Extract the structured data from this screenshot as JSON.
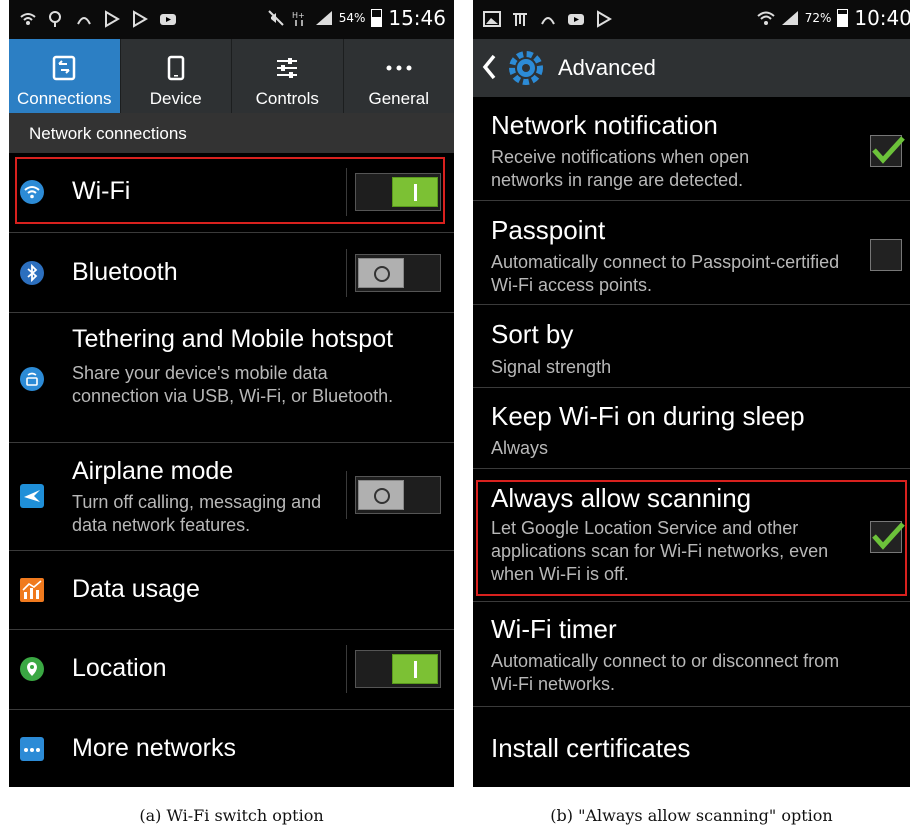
{
  "phone_a": {
    "status": {
      "battery_pct": "54%",
      "time": "15:46",
      "battery_level": 54
    },
    "tabs": [
      {
        "label": "Connections",
        "icon": "connections-icon",
        "active": true
      },
      {
        "label": "Device",
        "icon": "device-icon",
        "active": false
      },
      {
        "label": "Controls",
        "icon": "controls-icon",
        "active": false
      },
      {
        "label": "General",
        "icon": "more-dots-icon",
        "active": false
      }
    ],
    "section_header": "Network connections",
    "rows": [
      {
        "title": "Wi-Fi",
        "icon": "wifi-icon",
        "toggle": "on"
      },
      {
        "title": "Bluetooth",
        "icon": "bluetooth-icon",
        "toggle": "off"
      },
      {
        "title": "Tethering and Mobile hotspot",
        "subtitle": "Share your device's mobile data connection via USB, Wi-Fi, or Bluetooth.",
        "icon": "hotspot-icon"
      },
      {
        "title": "Airplane mode",
        "subtitle": "Turn off calling, messaging and data network features.",
        "icon": "airplane-icon",
        "toggle": "off"
      },
      {
        "title": "Data usage",
        "icon": "data-usage-icon"
      },
      {
        "title": "Location",
        "icon": "location-icon",
        "toggle": "on"
      },
      {
        "title": "More networks",
        "icon": "more-networks-icon"
      }
    ],
    "caption": "(a) Wi-Fi switch option"
  },
  "phone_b": {
    "status": {
      "battery_pct": "72%",
      "time": "10:40",
      "battery_level": 72
    },
    "action_bar_title": "Advanced",
    "rows": [
      {
        "title": "Network notification",
        "subtitle": "Receive notifications when open networks in range are detected.",
        "checked": true
      },
      {
        "title": "Passpoint",
        "subtitle": "Automatically connect to Passpoint-certified Wi-Fi access points.",
        "checked": false
      },
      {
        "title": "Sort by",
        "subtitle": "Signal strength"
      },
      {
        "title": "Keep Wi-Fi on during sleep",
        "subtitle": "Always"
      },
      {
        "title": "Always allow scanning",
        "subtitle": "Let Google Location Service and other applications scan for Wi-Fi networks, even when Wi-Fi is off.",
        "checked": true
      },
      {
        "title": "Wi-Fi timer",
        "subtitle": "Automatically connect to or disconnect from Wi-Fi networks."
      },
      {
        "title": "Install certificates"
      }
    ],
    "caption": "(b) \"Always allow scanning\" option"
  },
  "colors": {
    "accent_blue": "#2c7fc4",
    "toggle_green": "#7cc134",
    "check_green": "#6cc23a",
    "highlight_red": "#d9211e"
  }
}
